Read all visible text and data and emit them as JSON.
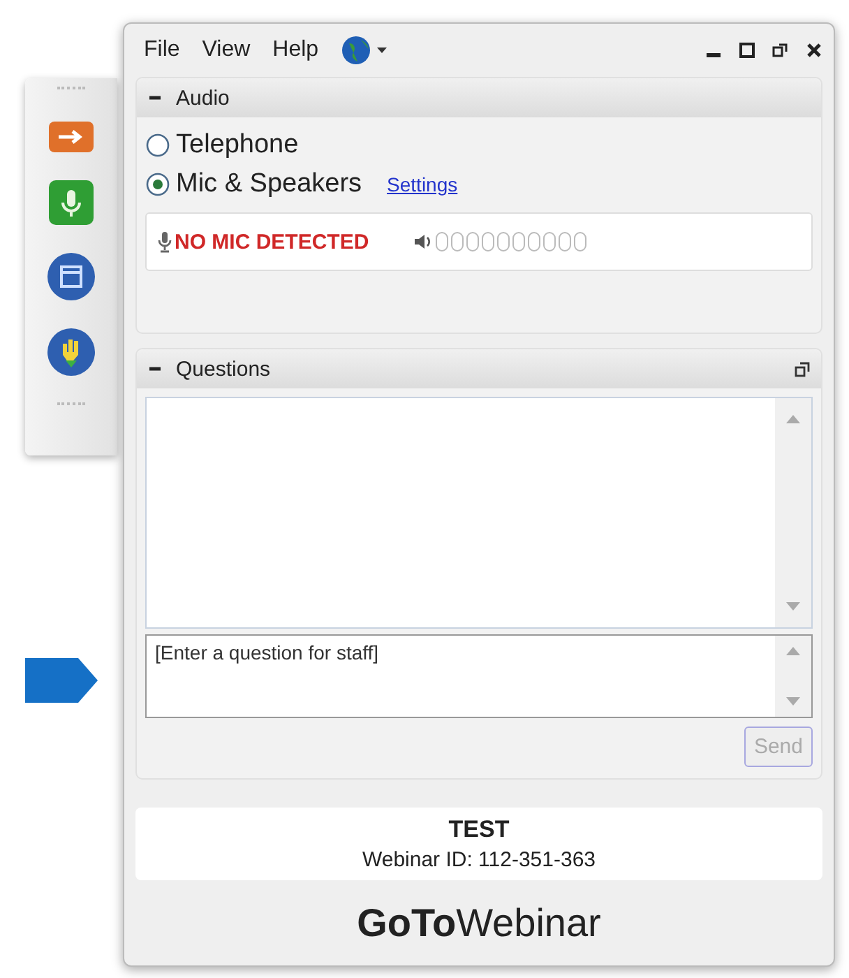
{
  "menu": [
    "File",
    "View",
    "Help"
  ],
  "side_toolbar": [
    {
      "kind": "arrow"
    },
    {
      "kind": "mic"
    },
    {
      "kind": "screen"
    },
    {
      "kind": "hand"
    }
  ],
  "audio": {
    "title": "Audio",
    "expanded": true,
    "options": [
      {
        "label": "Telephone",
        "selected": false
      },
      {
        "label": "Mic & Speakers",
        "selected": true
      }
    ],
    "settings_link": "Settings",
    "status": "NO MIC DETECTED",
    "level": 0
  },
  "questions": {
    "title": "Questions",
    "expanded": true,
    "placeholder": "[Enter a question for staff]",
    "send": {
      "label": "Send",
      "disabled": true
    }
  },
  "info": {
    "title": "TEST",
    "webinar_id": "Webinar ID: 112-351-363"
  },
  "logo": "**GoTo**Webinar"
}
